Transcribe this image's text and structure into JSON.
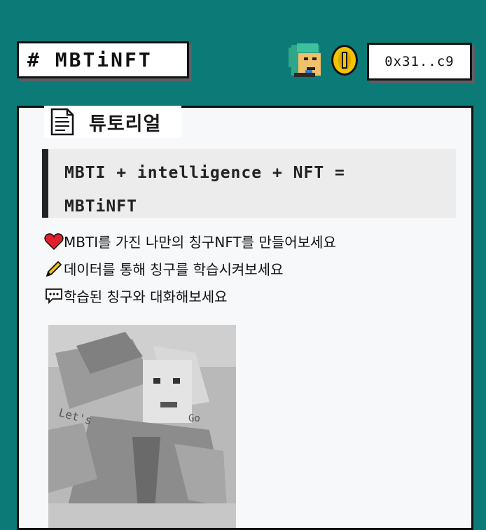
{
  "header": {
    "logo": "# MBTiNFT",
    "wallet_address": "0x31..c9"
  },
  "tutorial": {
    "tab_label": "튜토리얼",
    "quote": "MBTI + intelligence + NFT = MBTiNFT",
    "features": [
      {
        "icon": "heart-icon",
        "text": "MBTI를 가진 나만의 칭구NFT를 만들어보세요"
      },
      {
        "icon": "pencil-icon",
        "text": "데이터를 통해 칭구를 학습시켜보세요"
      },
      {
        "icon": "chat-bubble-icon",
        "text": "학습된 칭구와 대화해보세요"
      }
    ]
  },
  "colors": {
    "background": "#0c7b78",
    "card": "#f6f8fa",
    "border": "#111111",
    "heart": "#e0202a",
    "coin": "#f5c400"
  }
}
